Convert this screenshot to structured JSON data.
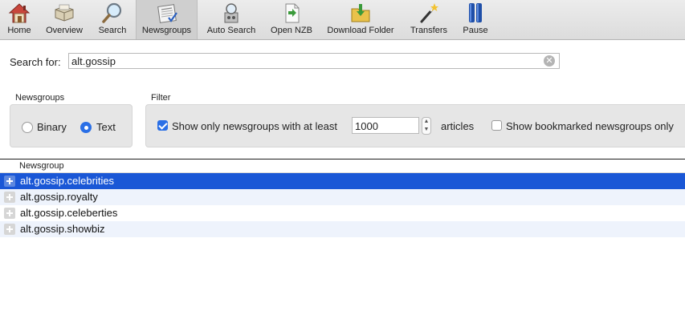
{
  "toolbar": {
    "items": [
      {
        "label": "Home",
        "icon": "home-icon"
      },
      {
        "label": "Overview",
        "icon": "overview-icon"
      },
      {
        "label": "Search",
        "icon": "magnifier-icon"
      },
      {
        "label": "Newsgroups",
        "icon": "newsgroups-icon",
        "active": true
      },
      {
        "label": "Auto Search",
        "icon": "auto-search-icon"
      },
      {
        "label": "Open NZB",
        "icon": "open-nzb-icon"
      },
      {
        "label": "Download Folder",
        "icon": "download-folder-icon"
      },
      {
        "label": "Transfers",
        "icon": "transfers-wand-icon"
      },
      {
        "label": "Pause",
        "icon": "pause-icon"
      }
    ]
  },
  "search": {
    "label": "Search for:",
    "value": "alt.gossip"
  },
  "newsgroups_group": {
    "title": "Newsgroups",
    "binary_label": "Binary",
    "text_label": "Text",
    "selected": "Text"
  },
  "filter_group": {
    "title": "Filter",
    "min_articles_label": "Show only newsgroups with at least",
    "min_articles_checked": true,
    "min_articles_value": "1000",
    "articles_suffix": "articles",
    "bookmarked_label": "Show bookmarked newsgroups only",
    "bookmarked_checked": false
  },
  "table": {
    "column_header": "Newsgroup",
    "rows": [
      {
        "name": "alt.gossip.celebrities",
        "selected": true
      },
      {
        "name": "alt.gossip.royalty",
        "selected": false
      },
      {
        "name": "alt.gossip.celeberties",
        "selected": false
      },
      {
        "name": "alt.gossip.showbiz",
        "selected": false
      }
    ]
  },
  "colors": {
    "selection": "#1a57d6",
    "accent": "#2a6fe6",
    "alt_row": "#eef3fc"
  }
}
